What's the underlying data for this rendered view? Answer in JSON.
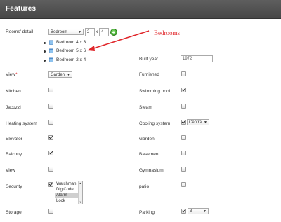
{
  "header": {
    "title": "Features"
  },
  "rooms": {
    "label": "Rooms' detail",
    "type_value": "Bedroom",
    "width_value": "2",
    "x_sep": "x",
    "length_value": "4",
    "items": [
      "Bedroom 4 x 3",
      "Bedroom 5 x 6",
      "Bedroom 2 x 4"
    ]
  },
  "annotation": {
    "text": "Bedrooms",
    "color": "#e0262a"
  },
  "fields": {
    "built_year": {
      "label": "Built year",
      "value": "1972"
    },
    "view_star": {
      "label": "View",
      "required": "*",
      "value": "Garden"
    },
    "furnished": {
      "label": "Furnished",
      "checked": false
    },
    "kitchen": {
      "label": "Kitchen",
      "checked": false
    },
    "swimming_pool": {
      "label": "Swimming pool",
      "checked": true
    },
    "jacuzzi": {
      "label": "Jacuzzi",
      "checked": false
    },
    "steam": {
      "label": "Steam",
      "checked": false
    },
    "heating_system": {
      "label": "Heating system",
      "checked": false
    },
    "cooling_system": {
      "label": "Cooling system",
      "checked": true,
      "value": "Central"
    },
    "elevator": {
      "label": "Elevator",
      "checked": true
    },
    "garden": {
      "label": "Garden",
      "checked": false
    },
    "balcony": {
      "label": "Balcony",
      "checked": true
    },
    "basement": {
      "label": "Basement",
      "checked": false
    },
    "view": {
      "label": "View",
      "checked": false
    },
    "gymnasium": {
      "label": "Gymnasium",
      "checked": false
    },
    "security": {
      "label": "Security",
      "checked": true,
      "options": [
        "Watchman",
        "DigiCode",
        "Alarm",
        "Lock"
      ],
      "selected": "Alarm"
    },
    "patio": {
      "label": "patio",
      "checked": false
    },
    "storage": {
      "label": "Storage",
      "checked": false
    },
    "parking": {
      "label": "Parking",
      "checked": true,
      "value": "3"
    }
  },
  "colors": {
    "header_bg": "#4f4f4f",
    "add_button": "#3aa82a"
  }
}
